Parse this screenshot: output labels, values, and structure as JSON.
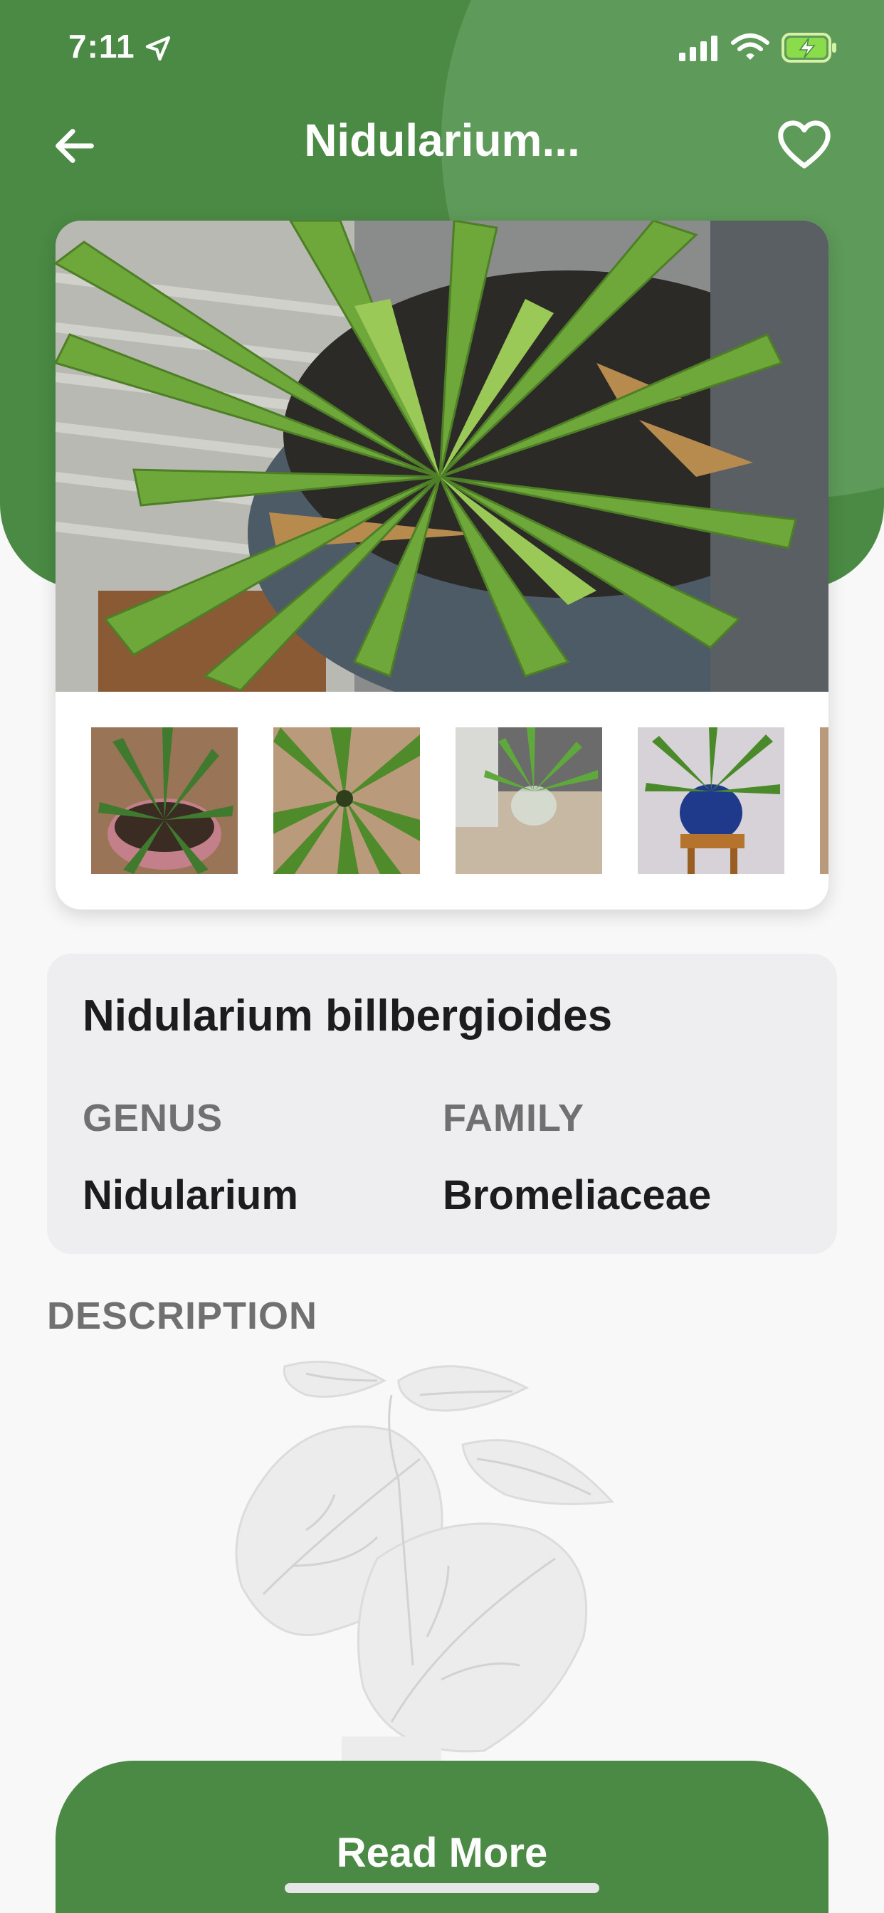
{
  "status_bar": {
    "time": "7:11"
  },
  "header": {
    "title": "Nidularium..."
  },
  "gallery": {
    "thumbnails": [
      "thumbnail-1",
      "thumbnail-2",
      "thumbnail-3",
      "thumbnail-4"
    ]
  },
  "info": {
    "species_name": "Nidularium billbergioides",
    "genus_label": "GENUS",
    "genus_value": "Nidularium",
    "family_label": "FAMILY",
    "family_value": "Bromeliaceae"
  },
  "description": {
    "label": "DESCRIPTION"
  },
  "actions": {
    "read_more_label": "Read More"
  },
  "colors": {
    "primary_green": "#4a8a44",
    "light_green": "#5e9a59",
    "card_bg": "#eeeef1",
    "label_gray": "#707070"
  },
  "icons": [
    "location-arrow-icon",
    "signal-icon",
    "wifi-icon",
    "battery-icon",
    "back-arrow-icon",
    "heart-icon",
    "plant-illustration"
  ]
}
